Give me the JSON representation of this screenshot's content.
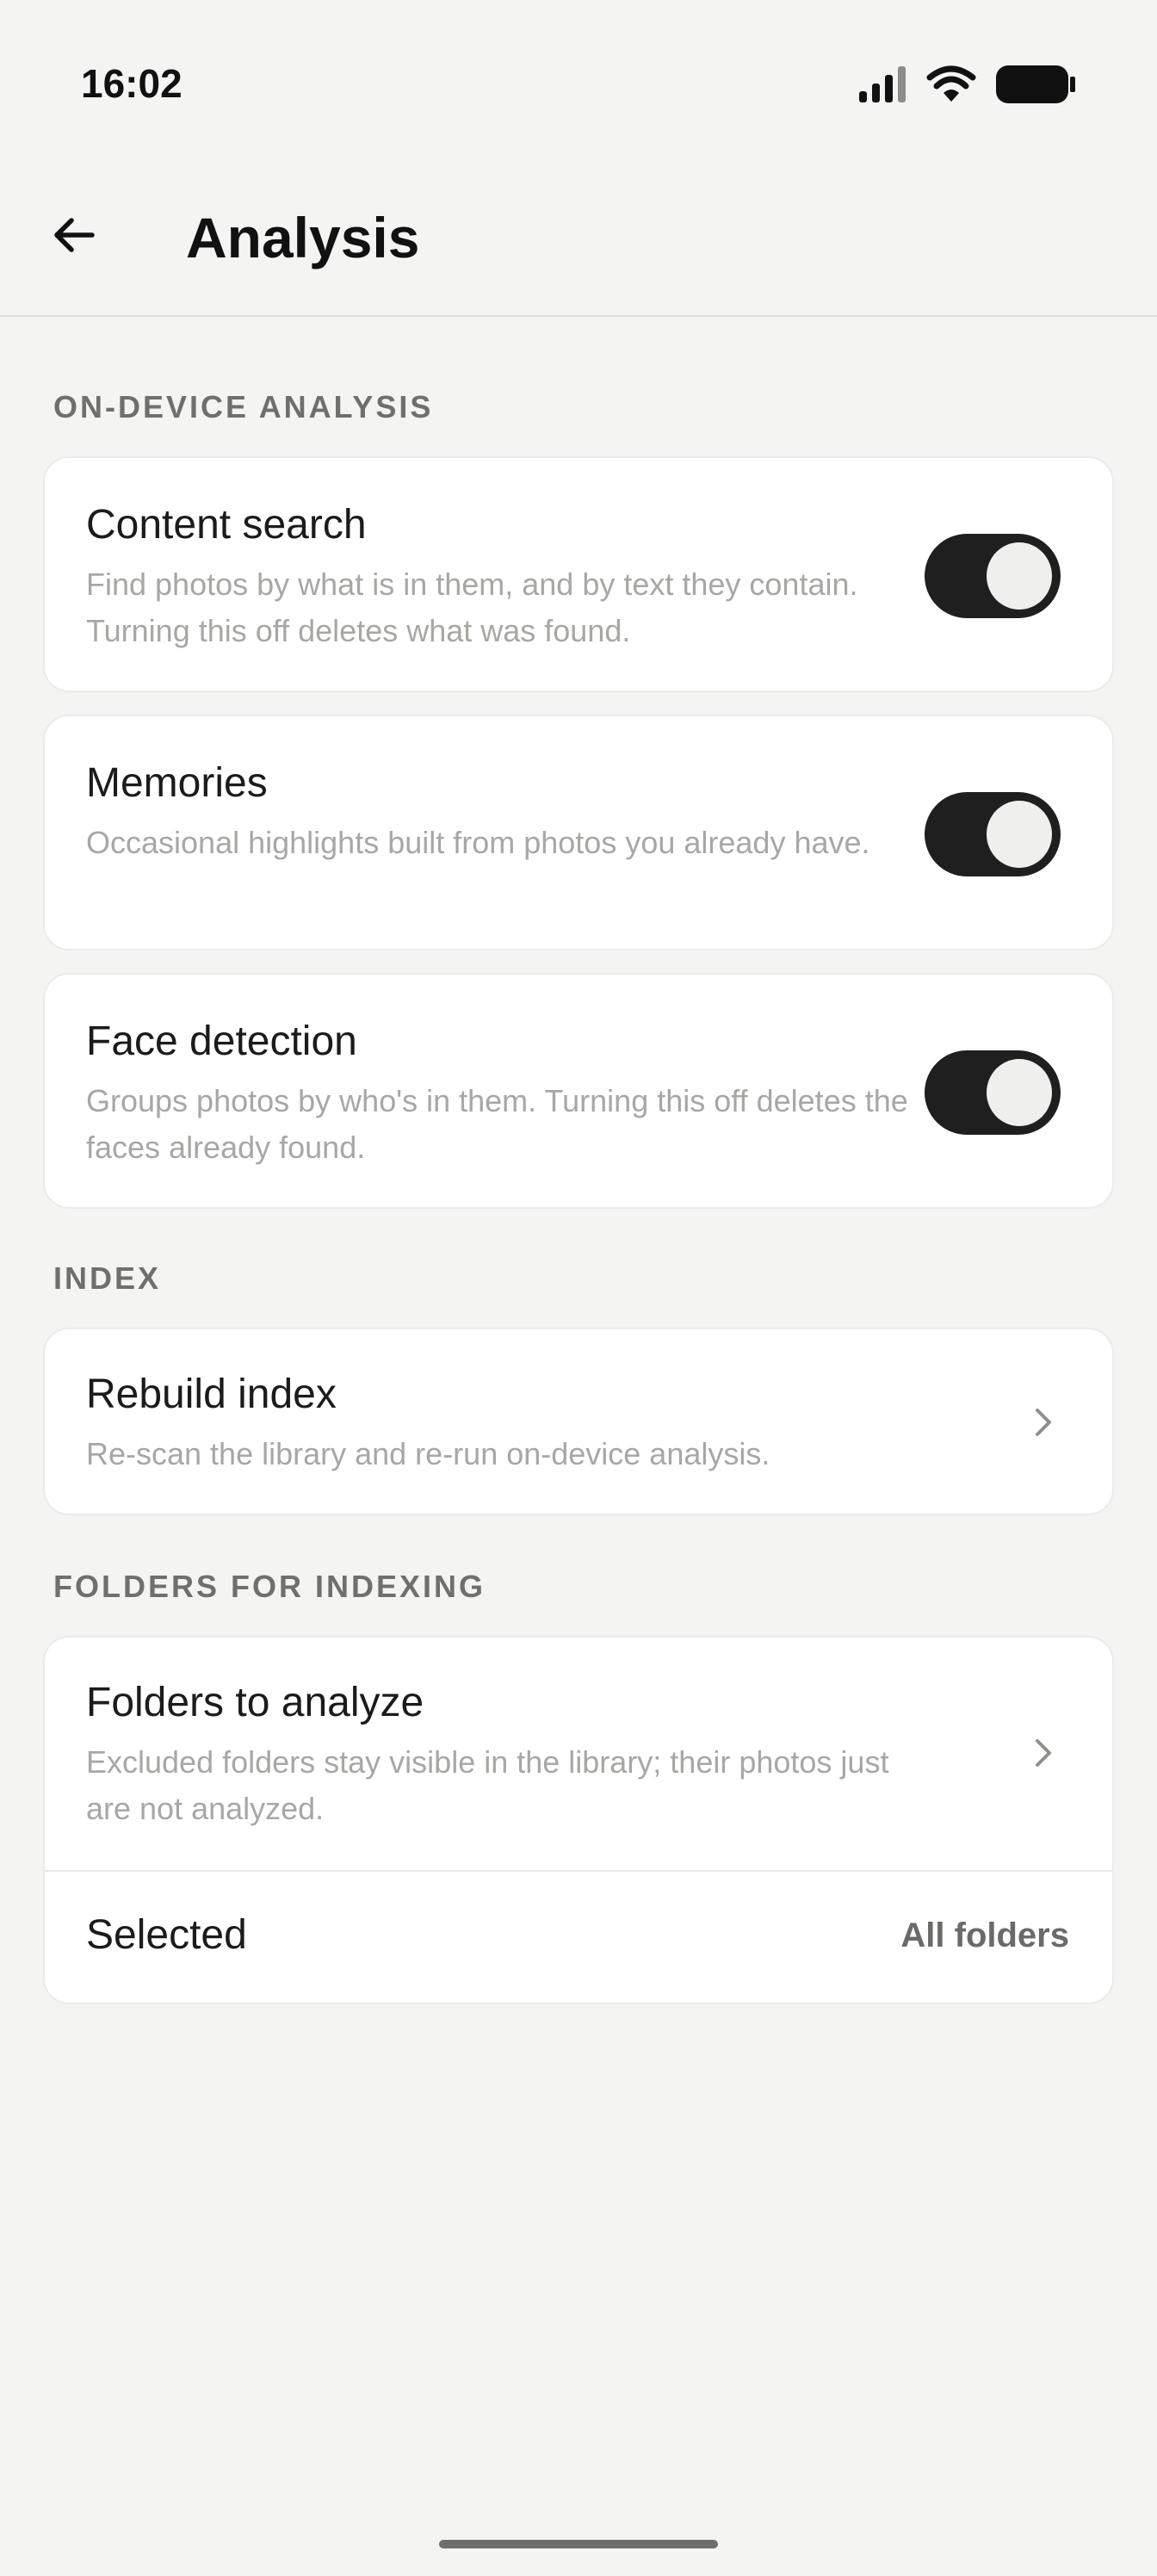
{
  "status_bar": {
    "time": "16:02",
    "icons": [
      "cellular-signal-icon",
      "wifi-icon",
      "battery-icon"
    ]
  },
  "app_bar": {
    "back_icon": "arrow-left-icon",
    "title": "Analysis"
  },
  "sections": {
    "on_device": {
      "header": "ON-DEVICE ANALYSIS",
      "items": [
        {
          "title": "Content search",
          "subtitle": "Find photos by what is in them, and by text they contain. Turning this off deletes what was found.",
          "toggle_on": true
        },
        {
          "title": "Memories",
          "subtitle": "Occasional highlights built from photos you already have.",
          "toggle_on": true
        },
        {
          "title": "Face detection",
          "subtitle": "Groups photos by who's in them. Turning this off deletes the faces already found.",
          "toggle_on": true
        }
      ]
    },
    "index": {
      "header": "INDEX",
      "rebuild": {
        "title": "Rebuild index",
        "subtitle": "Re-scan the library and re-run on-device analysis."
      }
    },
    "folders": {
      "header": "FOLDERS FOR INDEXING",
      "analyze": {
        "title": "Folders to analyze",
        "subtitle": "Excluded folders stay visible in the library; their photos just are not analyzed."
      },
      "selected": {
        "label": "Selected",
        "value": "All folders"
      }
    }
  },
  "colors": {
    "background": "#f4f4f3",
    "card": "#ffffff",
    "toggle_track": "#1f1f1f",
    "toggle_knob": "#efefed",
    "section_header": "#6f6f6c",
    "subtitle": "#a7a7a4"
  }
}
